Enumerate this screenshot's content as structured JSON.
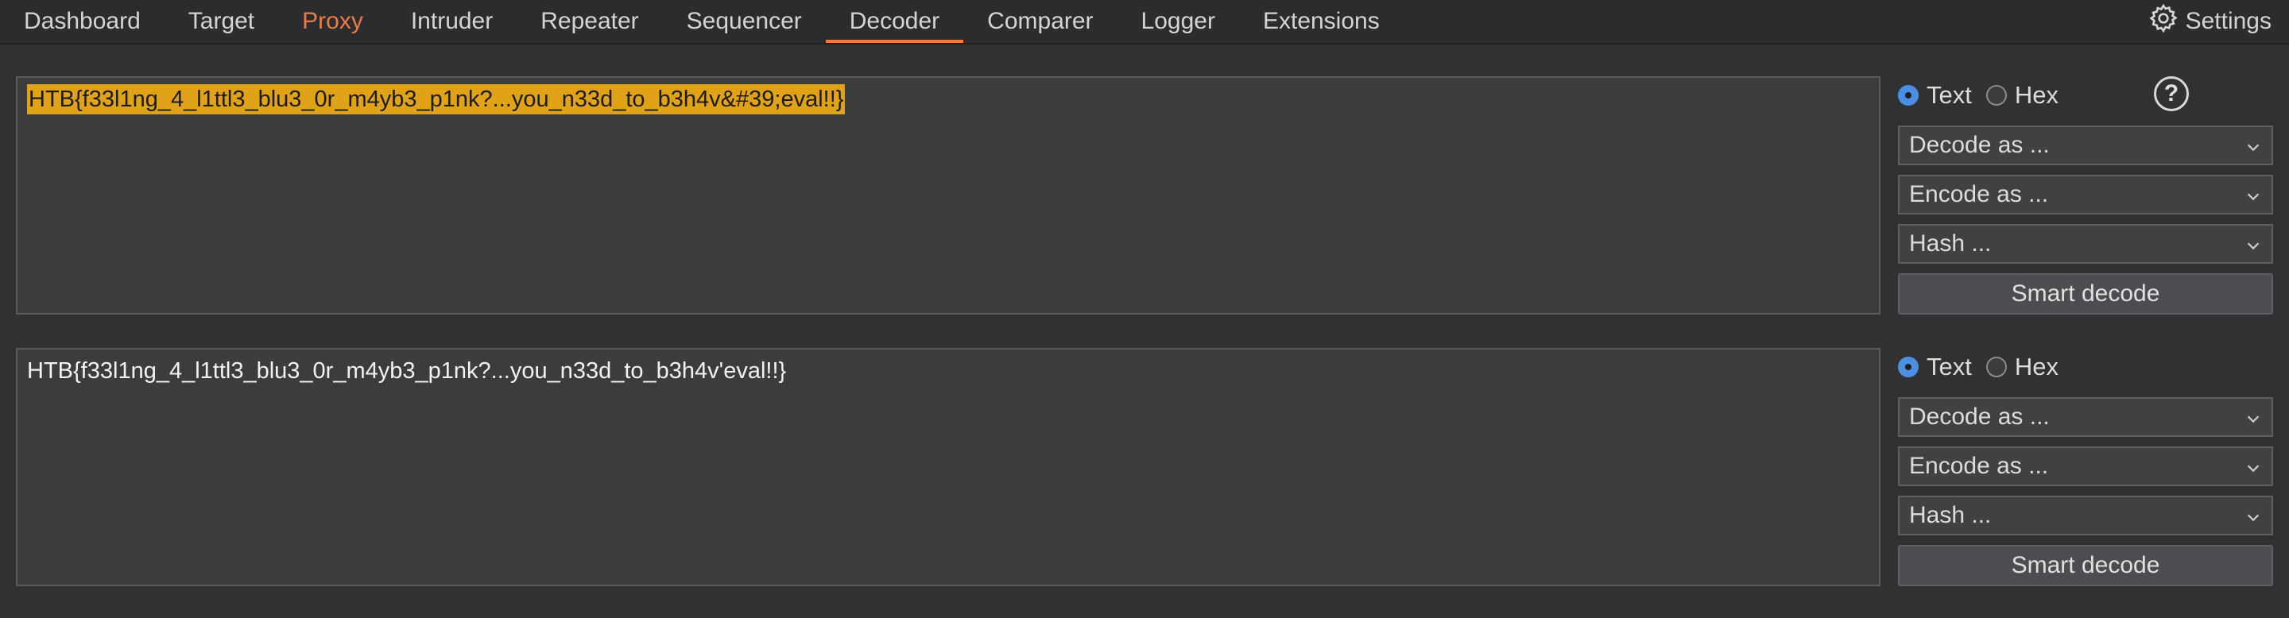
{
  "nav": {
    "tabs": [
      {
        "label": "Dashboard"
      },
      {
        "label": "Target"
      },
      {
        "label": "Proxy"
      },
      {
        "label": "Intruder"
      },
      {
        "label": "Repeater"
      },
      {
        "label": "Sequencer"
      },
      {
        "label": "Decoder"
      },
      {
        "label": "Comparer"
      },
      {
        "label": "Logger"
      },
      {
        "label": "Extensions"
      }
    ],
    "active_tab": "Decoder",
    "settings_label": "Settings"
  },
  "colors": {
    "accent": "#ee7a45",
    "selection": "#e0a217",
    "radio_selected": "#4a8fe0"
  },
  "panels": [
    {
      "text": "HTB{f33l1ng_4_l1ttl3_blu3_0r_m4yb3_p1nk?...you_n33d_to_b3h4v&#39;eval!!}",
      "text_selected": true,
      "mode_text_label": "Text",
      "mode_hex_label": "Hex",
      "selected_mode": "Text",
      "decode_label": "Decode as ...",
      "encode_label": "Encode as ...",
      "hash_label": "Hash ...",
      "smart_decode_label": "Smart decode"
    },
    {
      "text": "HTB{f33l1ng_4_l1ttl3_blu3_0r_m4yb3_p1nk?...you_n33d_to_b3h4v'eval!!}",
      "text_selected": false,
      "mode_text_label": "Text",
      "mode_hex_label": "Hex",
      "selected_mode": "Text",
      "decode_label": "Decode as ...",
      "encode_label": "Encode as ...",
      "hash_label": "Hash ...",
      "smart_decode_label": "Smart decode"
    }
  ],
  "help_icon": "question-circle-icon"
}
